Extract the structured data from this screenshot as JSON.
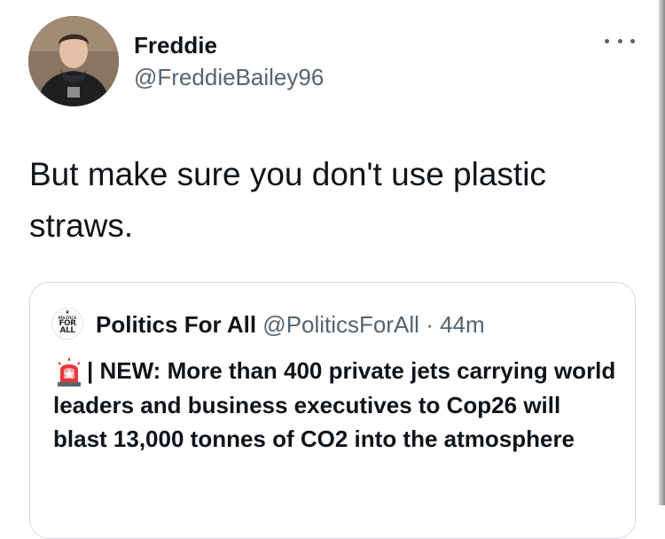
{
  "tweet": {
    "display_name": "Freddie",
    "handle": "@FreddieBailey96",
    "text": "But make sure you don't use plastic straws.",
    "more_icon": "more-horizontal-icon"
  },
  "quoted_tweet": {
    "avatar_lines": [
      "POLITICS",
      "FOR",
      "ALL"
    ],
    "display_name": "Politics For All",
    "handle": "@PoliticsForAll",
    "separator": "·",
    "time": "44m",
    "emoji_icon": "police-siren-icon",
    "text": "| NEW: More than 400 private jets carrying world leaders and business executives to Cop26 will blast 13,000 tonnes of CO2 into the atmosphere"
  },
  "colors": {
    "primary_text": "#0f1419",
    "secondary_text": "#536471",
    "card_border": "#cfd9de"
  }
}
